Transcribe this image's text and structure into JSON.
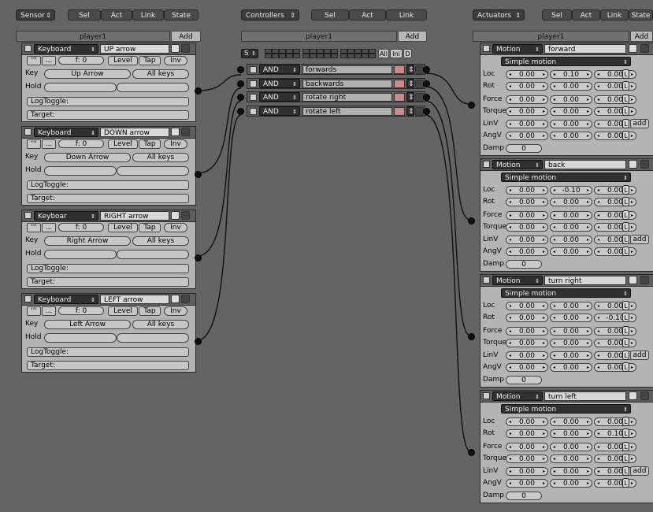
{
  "toolbar": {
    "sensor_dropdown": "Sensor",
    "controllers_dropdown": "Controllers",
    "actuators_dropdown": "Actuators",
    "sel": "Sel",
    "act": "Act",
    "link": "Link",
    "state": "State"
  },
  "owner": {
    "name": "player1",
    "add_label": "Add"
  },
  "sensors": [
    {
      "type": "Keyboard",
      "name": "UP arrow",
      "key": "Up Arrow"
    },
    {
      "type": "Keyboard",
      "name": "DOWN arrow",
      "key": "Down Arrow"
    },
    {
      "type": "Keyboar",
      "name": "RIGHT arrow",
      "key": "Right Arrow"
    },
    {
      "type": "Keyboard",
      "name": "LEFT arrow",
      "key": "Left Arrow"
    }
  ],
  "sensor_common": {
    "pulse_true": "'''",
    "pulse_false": "...",
    "freq": "f: 0",
    "level": "Level",
    "tap": "Tap",
    "inv": "Inv",
    "key_label": "Key",
    "hold_label": "Hold",
    "all_keys": "All keys",
    "logtoggle": "LogToggle:",
    "target": "Target:"
  },
  "controllers": {
    "state_label": "S",
    "all": "All",
    "ini": "Ini",
    "d": "D",
    "items": [
      {
        "type": "AND",
        "name": "forwards"
      },
      {
        "type": "AND",
        "name": "backwards"
      },
      {
        "type": "AND",
        "name": "rotate right"
      },
      {
        "type": "AND",
        "name": "rotate left"
      }
    ]
  },
  "actuator_common": {
    "mode": "Simple motion",
    "loc": "Loc",
    "rot": "Rot",
    "force": "Force",
    "torque": "Torque",
    "linv": "LinV",
    "angv": "AngV",
    "damp": "Damp",
    "l": "L",
    "add": "add"
  },
  "actuators": [
    {
      "type": "Motion",
      "name": "forward",
      "loc": [
        "0.00",
        "0.10",
        "0.00"
      ],
      "rot": [
        "0.00",
        "0.00",
        "0.00"
      ],
      "force": [
        "0.00",
        "0.00",
        "0.00"
      ],
      "torque": [
        "0.00",
        "0.00",
        "0.00"
      ],
      "linv": [
        "0.00",
        "0.00",
        "0.00"
      ],
      "angv": [
        "0.00",
        "0.00",
        "0.00"
      ],
      "damp": "0"
    },
    {
      "type": "Motion",
      "name": "back",
      "loc": [
        "0.00",
        "-0.10",
        "0.00"
      ],
      "rot": [
        "0.00",
        "0.00",
        "0.00"
      ],
      "force": [
        "0.00",
        "0.00",
        "0.00"
      ],
      "torque": [
        "0.00",
        "0.00",
        "0.00"
      ],
      "linv": [
        "0.00",
        "0.00",
        "0.00"
      ],
      "angv": [
        "0.00",
        "0.00",
        "0.00"
      ],
      "damp": "0"
    },
    {
      "type": "Motion",
      "name": "turn right",
      "loc": [
        "0.00",
        "0.00",
        "0.00"
      ],
      "rot": [
        "0.00",
        "0.00",
        "-0.10"
      ],
      "force": [
        "0.00",
        "0.00",
        "0.00"
      ],
      "torque": [
        "0.00",
        "0.00",
        "0.00"
      ],
      "linv": [
        "0.00",
        "0.00",
        "0.00"
      ],
      "angv": [
        "0.00",
        "0.00",
        "0.00"
      ],
      "damp": "0"
    },
    {
      "type": "Motion",
      "name": "turn left",
      "loc": [
        "0.00",
        "0.00",
        "0.00"
      ],
      "rot": [
        "0.00",
        "0.00",
        "0.10"
      ],
      "force": [
        "0.00",
        "0.00",
        "0.00"
      ],
      "torque": [
        "0.00",
        "0.00",
        "0.00"
      ],
      "linv": [
        "0.00",
        "0.00",
        "0.00"
      ],
      "angv": [
        "0.00",
        "0.00",
        "0.00"
      ],
      "damp": "0"
    }
  ],
  "colors": {
    "background": "#646464",
    "panel": "#b4b4b4",
    "header": "#5e5e5e",
    "dark_dropdown": "#303030"
  }
}
